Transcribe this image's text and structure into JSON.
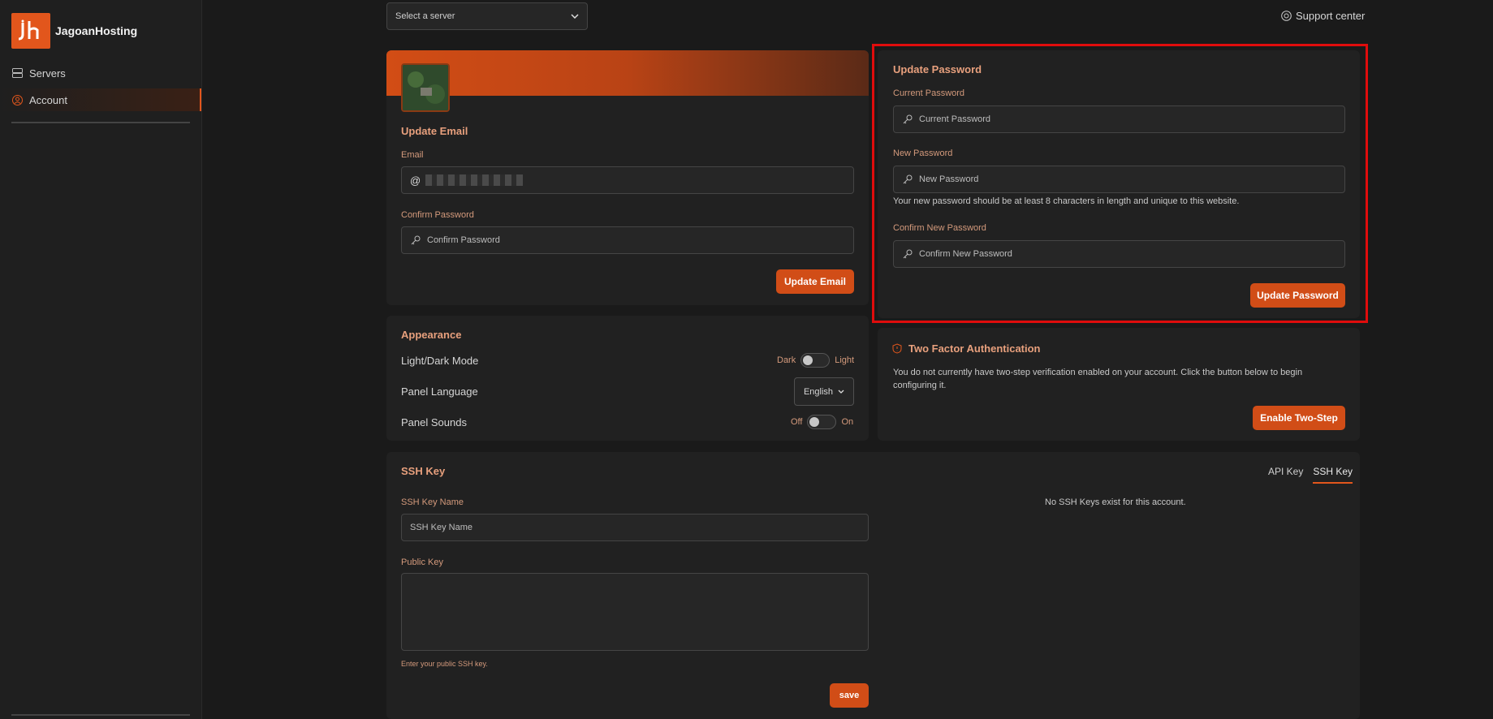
{
  "sidebar": {
    "brand": "JagoanHosting",
    "items": [
      {
        "label": "Servers",
        "icon": "server-icon"
      },
      {
        "label": "Account",
        "icon": "user-circle-icon",
        "active": true
      }
    ]
  },
  "header": {
    "server_select": "Select a server",
    "support": "Support center"
  },
  "update_email": {
    "title": "Update Email",
    "email_label": "Email",
    "email_value": "@",
    "confirm_label": "Confirm Password",
    "confirm_placeholder": "Confirm Password",
    "button": "Update Email"
  },
  "update_password": {
    "title": "Update Password",
    "current_label": "Current Password",
    "current_placeholder": "Current Password",
    "new_label": "New Password",
    "new_placeholder": "New Password",
    "hint": "Your new password should be at least 8 characters in length and unique to this website.",
    "confirm_label": "Confirm New Password",
    "confirm_placeholder": "Confirm New Password",
    "button": "Update Password"
  },
  "appearance": {
    "title": "Appearance",
    "mode_label": "Light/Dark Mode",
    "mode_left": "Dark",
    "mode_right": "Light",
    "language_label": "Panel Language",
    "language_value": "English",
    "sounds_label": "Panel Sounds",
    "sounds_left": "Off",
    "sounds_right": "On"
  },
  "two_factor": {
    "title": "Two Factor Authentication",
    "description": "You do not currently have two-step verification enabled on your account. Click the button below to begin configuring it.",
    "button": "Enable Two-Step"
  },
  "ssh": {
    "title": "SSH Key",
    "name_label": "SSH Key Name",
    "name_placeholder": "SSH Key Name",
    "public_label": "Public Key",
    "public_hint": "Enter your public SSH key.",
    "button": "save",
    "empty": "No SSH Keys exist for this account.",
    "tabs": [
      "API Key",
      "SSH Key"
    ]
  },
  "colors": {
    "accent": "#d14d17",
    "highlight_outline": "#e00c0c",
    "background": "#1a1a1a",
    "card": "#212121"
  }
}
